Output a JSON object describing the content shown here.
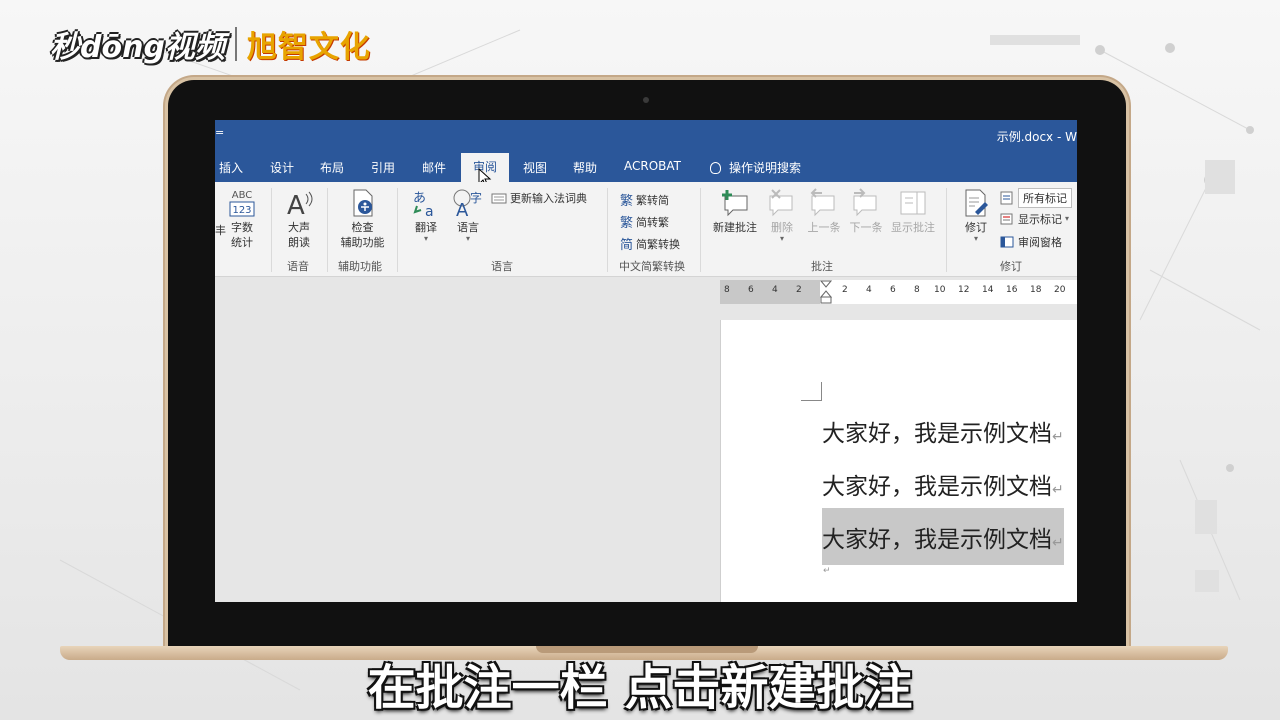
{
  "logo": {
    "brand": "秒dōng视频",
    "partner": "旭智文化"
  },
  "window": {
    "qat_caret": "=",
    "title": "示例.docx  -  W"
  },
  "tabs": [
    "插入",
    "设计",
    "布局",
    "引用",
    "邮件",
    "审阅",
    "视图",
    "帮助",
    "ACROBAT"
  ],
  "active_tab": "审阅",
  "tell_me": "操作说明搜索",
  "ribbon": {
    "proofing": {
      "cut_label": "丰",
      "word_count_icon": "ABC\n123",
      "word_count": [
        "字数",
        "统计"
      ]
    },
    "speech": {
      "read_aloud": [
        "大声",
        "朗读"
      ],
      "group": "语音"
    },
    "accessibility": {
      "check": [
        "检查",
        "辅助功能"
      ],
      "group": "辅助功能"
    },
    "language": {
      "translate": "翻译",
      "language": "语言",
      "update_ime": "更新输入法词典",
      "group": "语言"
    },
    "chinese": {
      "t2s": "繁转简",
      "s2t": "简转繁",
      "convert": "简繁转换",
      "group": "中文简繁转换"
    },
    "comments": {
      "new": "新建批注",
      "delete": "删除",
      "prev": "上一条",
      "next": "下一条",
      "show": "显示批注",
      "group": "批注"
    },
    "tracking": {
      "track": "修订",
      "markup_select": "所有标记",
      "show_markup": "显示标记",
      "pane": "审阅窗格",
      "group": "修订"
    }
  },
  "ruler_ticks": [
    "8",
    "6",
    "4",
    "2",
    "2",
    "4",
    "6",
    "8",
    "10",
    "12",
    "14",
    "16",
    "18",
    "20"
  ],
  "document": {
    "paragraphs": [
      "大家好，我是示例文档",
      "大家好，我是示例文档",
      "大家好，我是示例文档"
    ],
    "selected_index": 2
  },
  "subtitle": "在批注一栏  点击新建批注",
  "colors": {
    "ribbon_blue": "#2b579a",
    "selection": "#c8c8c8"
  }
}
